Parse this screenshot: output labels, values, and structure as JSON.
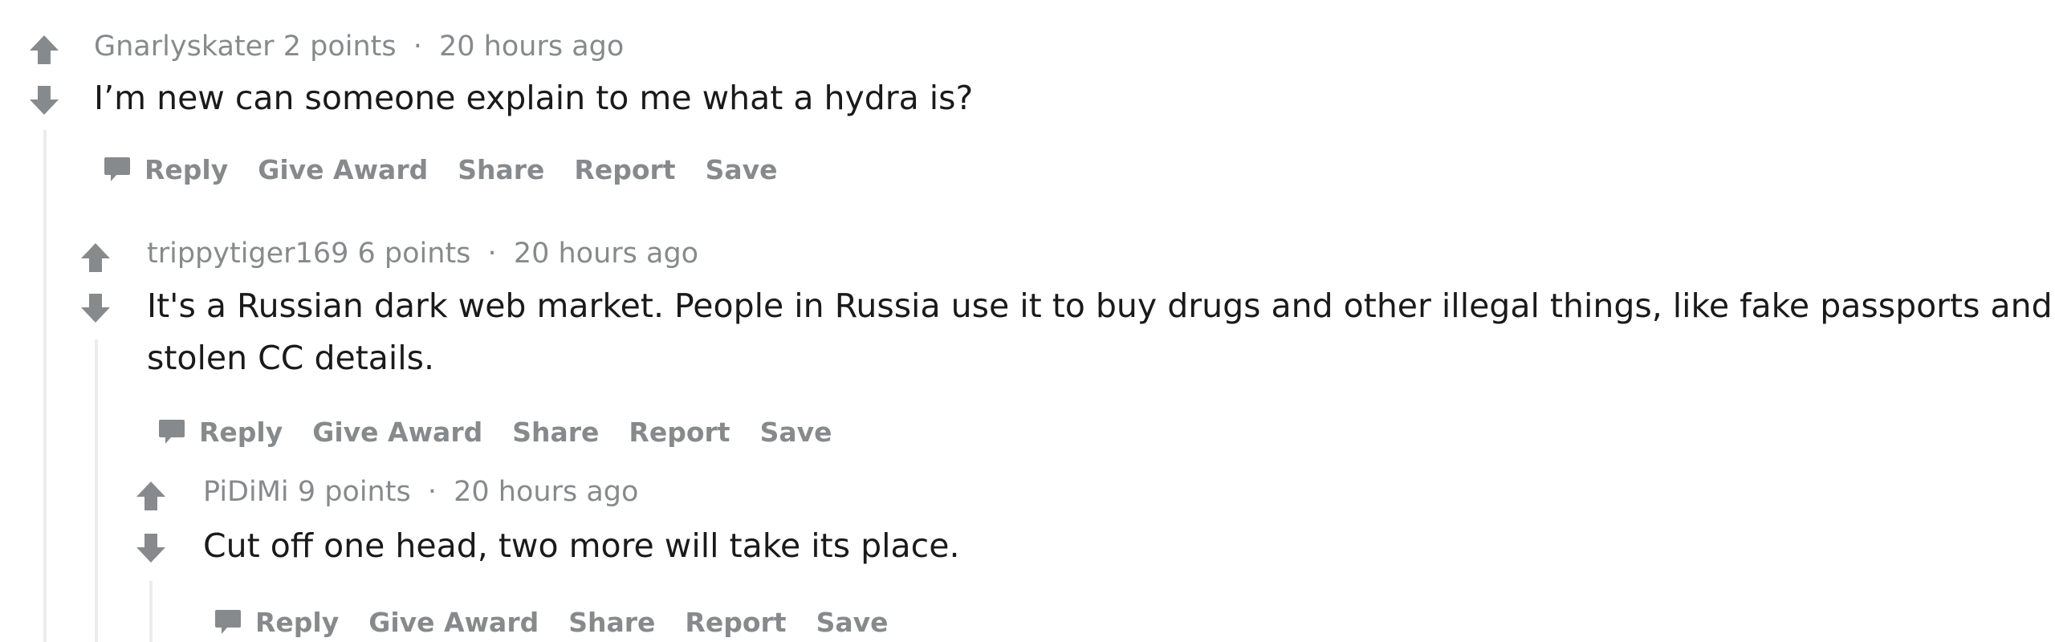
{
  "comments": [
    {
      "author": "Gnarlyskater",
      "points": "2 points",
      "separator": "·",
      "time": "20 hours ago",
      "body": "I’m new can someone explain to me what a hydra is?"
    },
    {
      "author": "trippytiger169",
      "points": "6 points",
      "separator": "·",
      "time": "20 hours ago",
      "body_line1": "It's a Russian dark web market. People in Russia use it to buy drugs and other illegal things, like fake passports and",
      "body_line2": "stolen CC details."
    },
    {
      "author": "PiDiMi",
      "points": "9 points",
      "separator": "·",
      "time": "20 hours ago",
      "body": "Cut off one head, two more will take its place."
    }
  ],
  "actions": {
    "reply": "Reply",
    "give_award": "Give Award",
    "share": "Share",
    "report": "Report",
    "save": "Save"
  },
  "colors": {
    "meta_text": "#878a8c",
    "body_text": "#1a1a1b",
    "thread_line": "#ececec",
    "vote_arrow": "#878a8c"
  },
  "icons": {
    "upvote": "upvote-arrow-icon",
    "downvote": "downvote-arrow-icon",
    "reply": "speech-bubble-icon"
  }
}
